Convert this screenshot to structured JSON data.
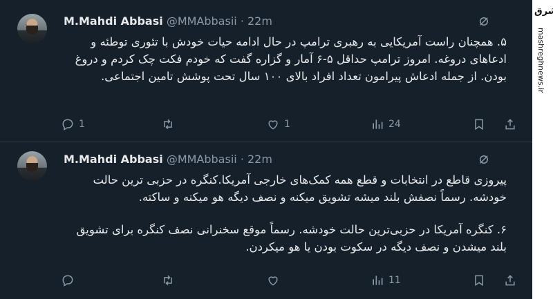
{
  "tweets": [
    {
      "author_name": "M.Mahdi Abbasi",
      "handle": "@MMAbbasii",
      "separator": "·",
      "time": "22m",
      "paragraphs": [
        "۵. همچنان راست آمریکایی به رهبری ترامپ در حال ادامه حیات خودش با تئوری توطئه و ادعاهای دروغه. امروز ترامپ حداقل ۵-۶ آمار و گزاره گفت که خودم فکت چک کردم و دروغ بودن. از جمله ادعاش پیرامون تعداد افراد بالای ۱۰۰ سال تحت پوشش تامین اجتماعی."
      ],
      "replies": "1",
      "retweets": "",
      "likes": "1",
      "views": "24"
    },
    {
      "author_name": "M.Mahdi Abbasi",
      "handle": "@MMAbbasii",
      "separator": "·",
      "time": "22m",
      "paragraphs": [
        "پیروزی قاطع در انتخابات و قطع همه کمک‌های خارجی آمریکا.کنگره در حزبی ترین حالت خودشه. رسماً نصفش بلند میشه تشویق میکنه و نصف دیگه هو میکنه و ساکته.",
        "۶. کنگره آمریکا در حزبی‌ترین حالت خودشه. رسماً موقع سخنرانی نصف کنگره برای تشویق بلند میشدن و نصف دیگه در سکوت بودن یا هو میکردن."
      ],
      "replies": "",
      "retweets": "",
      "likes": "",
      "views": "11"
    }
  ],
  "watermark": {
    "logo": "مشرق",
    "url": "mashreghnews.ir"
  },
  "colors": {
    "background": "#15202b",
    "text": "#e7e9ea",
    "muted": "#8b98a5"
  }
}
